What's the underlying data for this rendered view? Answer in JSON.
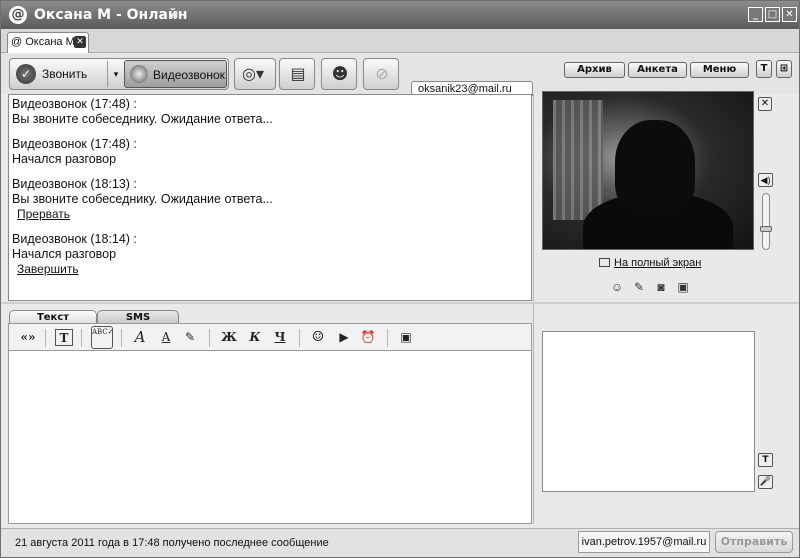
{
  "window": {
    "title": "Оксана М - Онлайн",
    "minimize_label": "_",
    "maximize_label": "□",
    "close_label": "✕"
  },
  "tabs": [
    {
      "label": "Оксана М",
      "close_label": "✕"
    }
  ],
  "toolbar": {
    "call_label": "Звонить",
    "call_dropdown": "▾",
    "video_call_label": "Видеозвонок",
    "icons": [
      "globe-icon",
      "floppy-save-icon",
      "contacts-icon",
      "attach-icon"
    ],
    "archive_label": "Архив",
    "profile_label": "Анкета",
    "menu_label": "Меню",
    "font_toggle_label": "T",
    "layout_toggle_label": "⊞"
  },
  "chat": {
    "contact_email": "oksanik23@mail.ru",
    "messages": [
      {
        "header": "Видеозвонок (17:48) :",
        "text": "Вы звоните собеседнику. Ожидание ответа...",
        "link": ""
      },
      {
        "header": "Видеозвонок (17:48) :",
        "text": "Начался разговор",
        "link": ""
      },
      {
        "header": "Видеозвонок (18:13) :",
        "text": "Вы звоните собеседнику. Ожидание ответа...",
        "link": "Прервать"
      },
      {
        "header": "Видеозвонок (18:14) :",
        "text": "Начался разговор",
        "link": "Завершить"
      }
    ]
  },
  "video": {
    "close_label": "✕",
    "volume_label": "◀)",
    "volume_level": 0.35,
    "fullscreen_label": "На полный экран",
    "control_icons": [
      "user-audio-icon",
      "pen-draw-icon",
      "camera-icon",
      "camcorder-icon"
    ]
  },
  "input": {
    "tab_text": "Текст",
    "tab_sms": "SMS",
    "format_buttons": [
      "«»",
      "T",
      "ABC✓",
      "A",
      "A",
      "✎",
      "Ж",
      "К",
      "Ч",
      "☺",
      "▶",
      "⏰",
      "▣"
    ],
    "side_buttons": [
      "T",
      "🎤"
    ]
  },
  "status": {
    "text": "21 августа 2011 года в 17:48 получено последнее сообщение",
    "account_email": "ivan.petrov.1957@mail.ru",
    "send_label": "Отправить"
  }
}
